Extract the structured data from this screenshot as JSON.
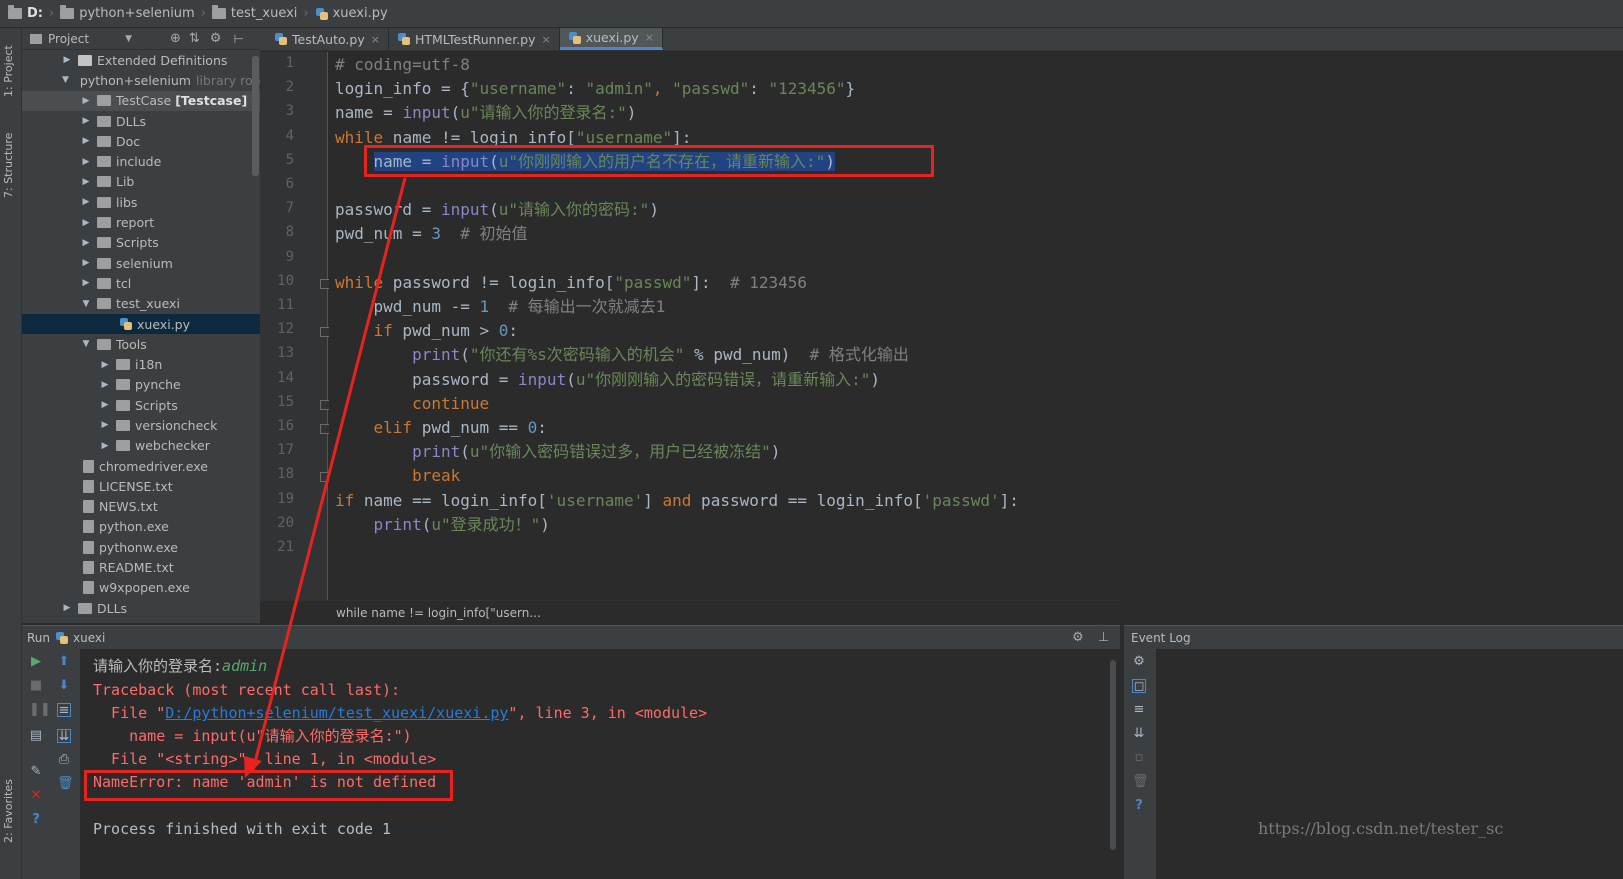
{
  "breadcrumb": {
    "drive": "D:",
    "folder1": "python+selenium",
    "folder2": "test_xuexi",
    "file": "xuexi.py"
  },
  "left_stripe": {
    "project_tab": "1: Project",
    "structure_tab": "7: Structure",
    "favorites_tab": "2: Favorites"
  },
  "project_panel": {
    "title": "Project",
    "items": [
      {
        "label": "Extended Definitions",
        "type": "ext",
        "indent": 0
      },
      {
        "label": "python+selenium",
        "extra": "library roo",
        "type": "folder-open",
        "indent": 0
      },
      {
        "label": "TestCase",
        "bold": "[Testcase]",
        "type": "folder",
        "indent": 1
      },
      {
        "label": "DLLs",
        "type": "folder",
        "indent": 1
      },
      {
        "label": "Doc",
        "type": "folder",
        "indent": 1
      },
      {
        "label": "include",
        "type": "folder",
        "indent": 1
      },
      {
        "label": "Lib",
        "type": "folder",
        "indent": 1
      },
      {
        "label": "libs",
        "type": "folder",
        "indent": 1
      },
      {
        "label": "report",
        "type": "folder",
        "indent": 1
      },
      {
        "label": "Scripts",
        "type": "folder",
        "indent": 1
      },
      {
        "label": "selenium",
        "type": "folder",
        "indent": 1
      },
      {
        "label": "tcl",
        "type": "folder",
        "indent": 1
      },
      {
        "label": "test_xuexi",
        "type": "folder-open",
        "indent": 1
      },
      {
        "label": "xuexi.py",
        "type": "py",
        "indent": 3
      },
      {
        "label": "Tools",
        "type": "folder-open",
        "indent": 1
      },
      {
        "label": "i18n",
        "type": "folder",
        "indent": 2
      },
      {
        "label": "pynche",
        "type": "folder",
        "indent": 2
      },
      {
        "label": "Scripts",
        "type": "folder",
        "indent": 2
      },
      {
        "label": "versioncheck",
        "type": "folder",
        "indent": 2
      },
      {
        "label": "webchecker",
        "type": "folder",
        "indent": 2
      },
      {
        "label": "chromedriver.exe",
        "type": "file",
        "indent": 1
      },
      {
        "label": "LICENSE.txt",
        "type": "file",
        "indent": 1
      },
      {
        "label": "NEWS.txt",
        "type": "file",
        "indent": 1
      },
      {
        "label": "python.exe",
        "type": "file",
        "indent": 1
      },
      {
        "label": "pythonw.exe",
        "type": "file",
        "indent": 1
      },
      {
        "label": "README.txt",
        "type": "file",
        "indent": 1
      },
      {
        "label": "w9xpopen.exe",
        "type": "file",
        "indent": 1
      },
      {
        "label": "DLLs",
        "type": "folder",
        "indent": 0
      }
    ]
  },
  "tabs": [
    {
      "label": "TestAuto.py",
      "active": false
    },
    {
      "label": "HTMLTestRunner.py",
      "active": false
    },
    {
      "label": "xuexi.py",
      "active": true
    }
  ],
  "code_lines": [
    [
      [
        "cmt",
        "# coding=utf-8"
      ]
    ],
    [
      [
        "",
        "login_info = {"
      ],
      [
        "str",
        "\"username\""
      ],
      [
        "",
        ": "
      ],
      [
        "str",
        "\"admin\""
      ],
      [
        "kw",
        ", "
      ],
      [
        "str",
        "\"passwd\""
      ],
      [
        "",
        ": "
      ],
      [
        "str",
        "\"123456\""
      ],
      [
        "",
        "}"
      ]
    ],
    [
      [
        "",
        "name = "
      ],
      [
        "bi",
        "input"
      ],
      [
        "",
        "("
      ],
      [
        "str",
        "u\"请输入你的登录名:\""
      ],
      [
        "",
        ")"
      ]
    ],
    [
      [
        "kw",
        "while"
      ],
      [
        "",
        " name != login_info["
      ],
      [
        "str",
        "\"username\""
      ],
      [
        "",
        "]:"
      ]
    ],
    [
      [
        "sel",
        "    "
      ],
      [
        "sel",
        "name = "
      ],
      [
        "selbi",
        "input"
      ],
      [
        "sel",
        "("
      ],
      [
        "selstr",
        "u\"你刚刚输入的用户名不存在，请重新输入:\""
      ],
      [
        "sel",
        ")"
      ]
    ],
    [],
    [
      [
        "",
        "password = "
      ],
      [
        "bi",
        "input"
      ],
      [
        "",
        "("
      ],
      [
        "str",
        "u\"请输入你的密码:\""
      ],
      [
        "",
        ")"
      ]
    ],
    [
      [
        "",
        "pwd_num = "
      ],
      [
        "num",
        "3"
      ],
      [
        "cmt",
        "  # 初始值"
      ]
    ],
    [],
    [
      [
        "kw",
        "while"
      ],
      [
        "",
        " password != login_info["
      ],
      [
        "str",
        "\"passwd\""
      ],
      [
        "",
        "]:  "
      ],
      [
        "cmt",
        "# 123456"
      ]
    ],
    [
      [
        "",
        "    pwd_num -= "
      ],
      [
        "num",
        "1"
      ],
      [
        "cmt",
        "  # 每输出一次就减去1"
      ]
    ],
    [
      [
        "",
        "    "
      ],
      [
        "kw",
        "if"
      ],
      [
        "",
        " pwd_num > "
      ],
      [
        "num",
        "0"
      ],
      [
        "",
        ":"
      ]
    ],
    [
      [
        "",
        "        "
      ],
      [
        "bi",
        "print"
      ],
      [
        "",
        "("
      ],
      [
        "str",
        "\"你还有%s次密码输入的机会\""
      ],
      [
        "",
        " % pwd_num)  "
      ],
      [
        "cmt",
        "# 格式化输出"
      ]
    ],
    [
      [
        "",
        "        password = "
      ],
      [
        "bi",
        "input"
      ],
      [
        "",
        "("
      ],
      [
        "str",
        "u\"你刚刚输入的密码错误，请重新输入:\""
      ],
      [
        "",
        ")"
      ]
    ],
    [
      [
        "",
        "        "
      ],
      [
        "kw",
        "continue"
      ]
    ],
    [
      [
        "",
        "    "
      ],
      [
        "kw",
        "elif"
      ],
      [
        "",
        " pwd_num == "
      ],
      [
        "num",
        "0"
      ],
      [
        "",
        ":"
      ]
    ],
    [
      [
        "",
        "        "
      ],
      [
        "bi",
        "print"
      ],
      [
        "",
        "("
      ],
      [
        "str",
        "u\"你输入密码错误过多，用户已经被冻结\""
      ],
      [
        "",
        ")"
      ]
    ],
    [
      [
        "",
        "        "
      ],
      [
        "kw",
        "break"
      ]
    ],
    [
      [
        "kw",
        "if"
      ],
      [
        "",
        " name == login_info["
      ],
      [
        "str",
        "'username'"
      ],
      [
        "",
        "] "
      ],
      [
        "kw",
        "and"
      ],
      [
        "",
        " password == login_info["
      ],
      [
        "str",
        "'passwd'"
      ],
      [
        "",
        "]:"
      ]
    ],
    [
      [
        "",
        "    "
      ],
      [
        "bi",
        "print"
      ],
      [
        "",
        "("
      ],
      [
        "str",
        "u\"登录成功！\""
      ],
      [
        "",
        ")"
      ]
    ],
    []
  ],
  "line_numbers": [
    "1",
    "2",
    "3",
    "4",
    "5",
    "6",
    "7",
    "8",
    "9",
    "10",
    "11",
    "12",
    "13",
    "14",
    "15",
    "16",
    "17",
    "18",
    "19",
    "20",
    "21"
  ],
  "editor_breadcrumb": "while name != login_info[\"usern...",
  "run_panel": {
    "label": "Run",
    "config": "xuexi"
  },
  "console": {
    "prompt": "请输入你的登录名:",
    "typed": "admin",
    "traceback_header": "Traceback (most recent call last):",
    "file1_prefix": "  File \"",
    "file1_link": "D:/python+selenium/test_xuexi/xuexi.py",
    "file1_suffix": "\", line 3, in <module>",
    "code_line": "    name = input(u\"请输入你的登录名:\")",
    "file2": "  File \"<string>\", line 1, in <module>",
    "error": "NameError: name 'admin' is not defined",
    "exit": "Process finished with exit code 1"
  },
  "event_log": {
    "title": "Event Log"
  },
  "watermark": "https://blog.csdn.net/tester_sc",
  "colors": {
    "annotation_red": "#e8231f",
    "keyword": "#cc7832",
    "string": "#6a8759",
    "error": "#ff6b68",
    "selection": "#214283"
  }
}
